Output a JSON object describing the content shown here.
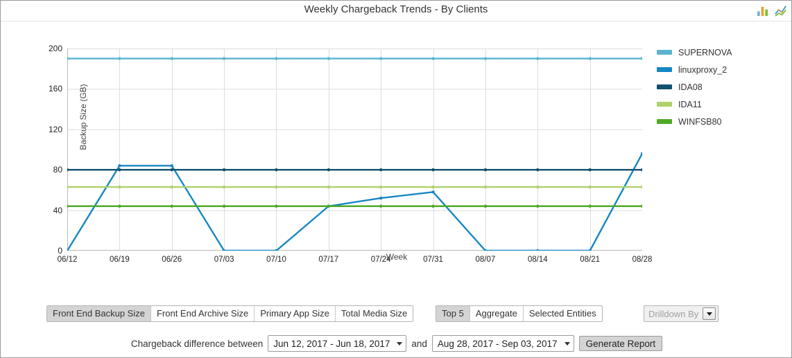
{
  "header": {
    "title": "Weekly Chargeback Trends - By Clients",
    "icons": [
      {
        "name": "bar-chart-icon",
        "label": "Bar Chart"
      },
      {
        "name": "line-chart-icon",
        "label": "Line Chart"
      }
    ]
  },
  "chart_data": {
    "type": "line",
    "title": "Weekly Chargeback Trends - By Clients",
    "xlabel": "Week",
    "ylabel": "Backup Size (GB)",
    "ylim": [
      0,
      200
    ],
    "yticks": [
      0,
      40,
      80,
      120,
      160,
      200
    ],
    "grid": true,
    "legend_position": "right",
    "categories": [
      "06/12",
      "06/19",
      "06/26",
      "07/03",
      "07/10",
      "07/17",
      "07/24",
      "07/31",
      "08/07",
      "08/14",
      "08/21",
      "08/28"
    ],
    "series": [
      {
        "name": "SUPERNOVA",
        "color": "#5bb4d0",
        "values": [
          190,
          190,
          190,
          190,
          190,
          190,
          190,
          190,
          190,
          190,
          190,
          190
        ]
      },
      {
        "name": "linuxproxy_2",
        "color": "#1787c4",
        "values": [
          0,
          84,
          84,
          0,
          0,
          44,
          52,
          58,
          0,
          0,
          0,
          96
        ]
      },
      {
        "name": "IDA08",
        "color": "#11506e",
        "values": [
          80,
          80,
          80,
          80,
          80,
          80,
          80,
          80,
          80,
          80,
          80,
          80
        ]
      },
      {
        "name": "IDA11",
        "color": "#aed16a",
        "values": [
          63,
          63,
          63,
          63,
          63,
          63,
          63,
          63,
          63,
          63,
          63,
          63
        ]
      },
      {
        "name": "WINFSB80",
        "color": "#4faa28",
        "values": [
          44,
          44,
          44,
          44,
          44,
          44,
          44,
          44,
          44,
          44,
          44,
          44
        ]
      }
    ]
  },
  "controls": {
    "metric_buttons": [
      {
        "label": "Front End Backup Size",
        "active": true
      },
      {
        "label": "Front End Archive Size",
        "active": false
      },
      {
        "label": "Primary App Size",
        "active": false
      },
      {
        "label": "Total Media Size",
        "active": false
      }
    ],
    "scope_buttons": [
      {
        "label": "Top 5",
        "active": true
      },
      {
        "label": "Aggregate",
        "active": false
      },
      {
        "label": "Selected Entities",
        "active": false
      }
    ],
    "drilldown_label": "Drilldown By"
  },
  "footer": {
    "prefix_label": "Chargeback difference between",
    "range_start": "Jun 12, 2017 - Jun 18, 2017",
    "conjunction": "and",
    "range_end": "Aug 28, 2017 - Sep 03, 2017",
    "generate_label": "Generate Report"
  }
}
